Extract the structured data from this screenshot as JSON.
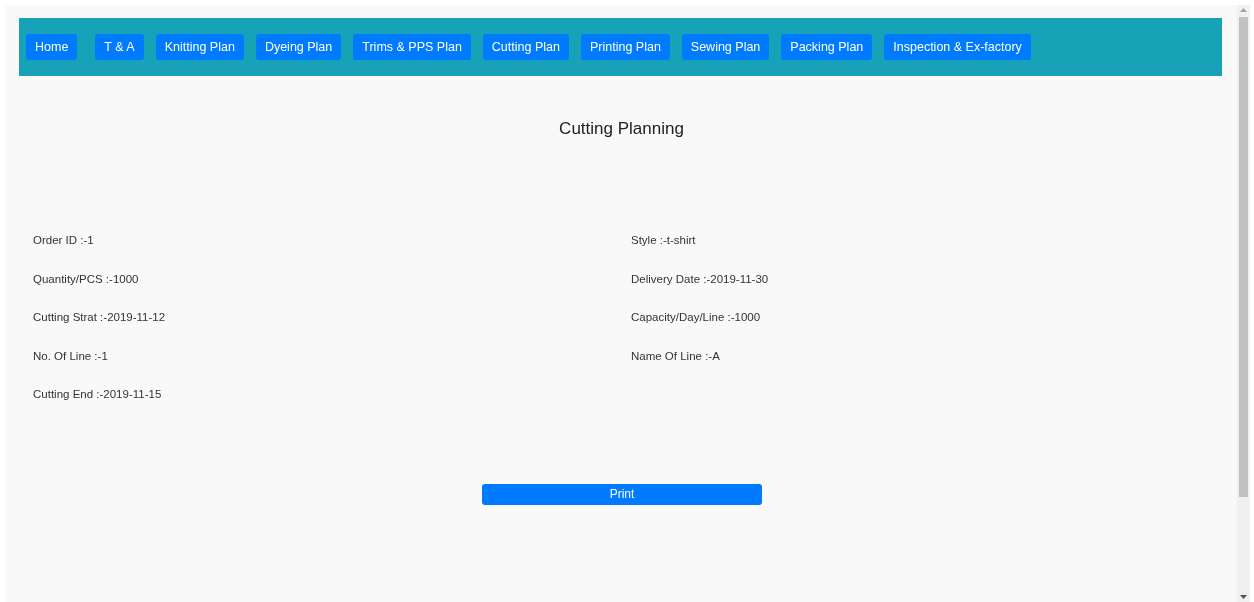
{
  "nav": [
    {
      "label": "Home"
    },
    {
      "label": "T & A"
    },
    {
      "label": "Knitting Plan"
    },
    {
      "label": "Dyeing Plan"
    },
    {
      "label": "Trims & PPS Plan"
    },
    {
      "label": "Cutting Plan"
    },
    {
      "label": "Printing Plan"
    },
    {
      "label": "Sewing Plan"
    },
    {
      "label": "Packing Plan"
    },
    {
      "label": "Inspection & Ex-factory"
    }
  ],
  "title": "Cutting Planning",
  "fields_left": [
    "Order ID :-1",
    "Quantity/PCS :-1000",
    "Cutting Strat :-2019-11-12",
    "No. Of Line :-1",
    "Cutting End :-2019-11-15"
  ],
  "fields_right": [
    "Style :-t-shirt",
    "Delivery Date :-2019-11-30",
    "Capacity/Day/Line :-1000",
    "Name Of Line :-A"
  ],
  "print_button": "Print"
}
